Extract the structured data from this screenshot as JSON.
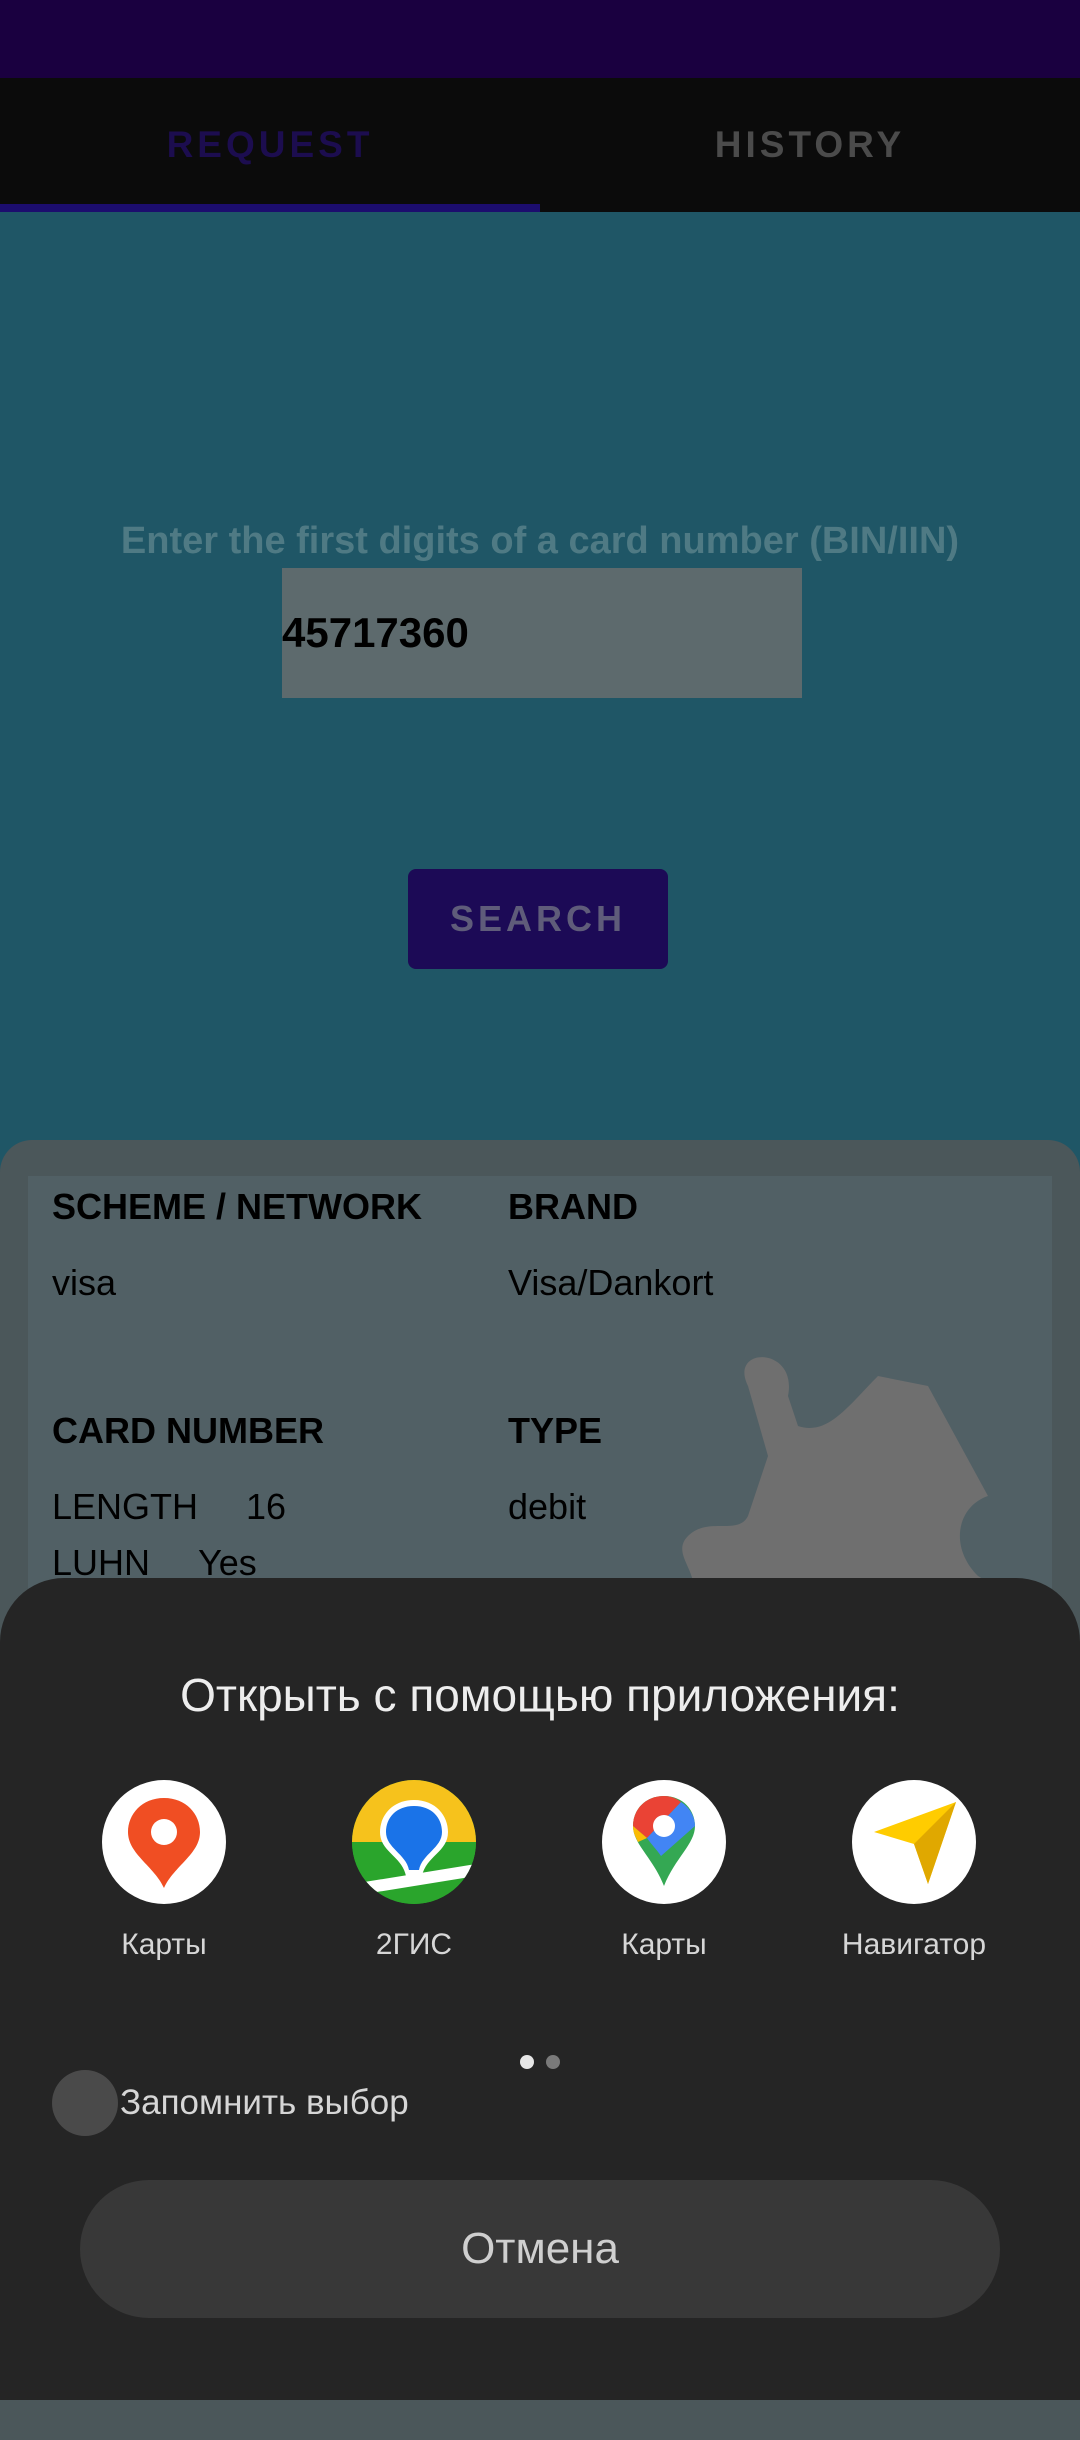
{
  "tabs": [
    {
      "label": "REQUEST",
      "active": true
    },
    {
      "label": "HISTORY",
      "active": false
    }
  ],
  "request": {
    "prompt": "Enter the first digits of a card number (BIN/IIN)",
    "bin_value": "45717360",
    "search_label": "SEARCH"
  },
  "result": {
    "scheme_header": "SCHEME / NETWORK",
    "scheme_value": "visa",
    "brand_header": "BRAND",
    "brand_value": "Visa/Dankort",
    "card_number_header": "CARD NUMBER",
    "length_label": "LENGTH",
    "length_value": "16",
    "luhn_label": "LUHN",
    "luhn_value": "Yes",
    "type_header": "TYPE",
    "type_value": "debit"
  },
  "chooser": {
    "title": "Открыть с помощью приложения:",
    "apps": [
      {
        "label": "Карты",
        "icon": "yandex-maps-icon"
      },
      {
        "label": "2ГИС",
        "icon": "2gis-icon"
      },
      {
        "label": "Карты",
        "icon": "google-maps-icon"
      },
      {
        "label": "Навигатор",
        "icon": "yandex-navigator-icon"
      }
    ],
    "remember_label": "Запомнить выбор",
    "cancel_label": "Отмена",
    "page_count": 2,
    "current_page": 1
  },
  "colors": {
    "accent": "#1c0a56",
    "status_bar": "#1a0040",
    "sheet_bg": "#252525"
  }
}
